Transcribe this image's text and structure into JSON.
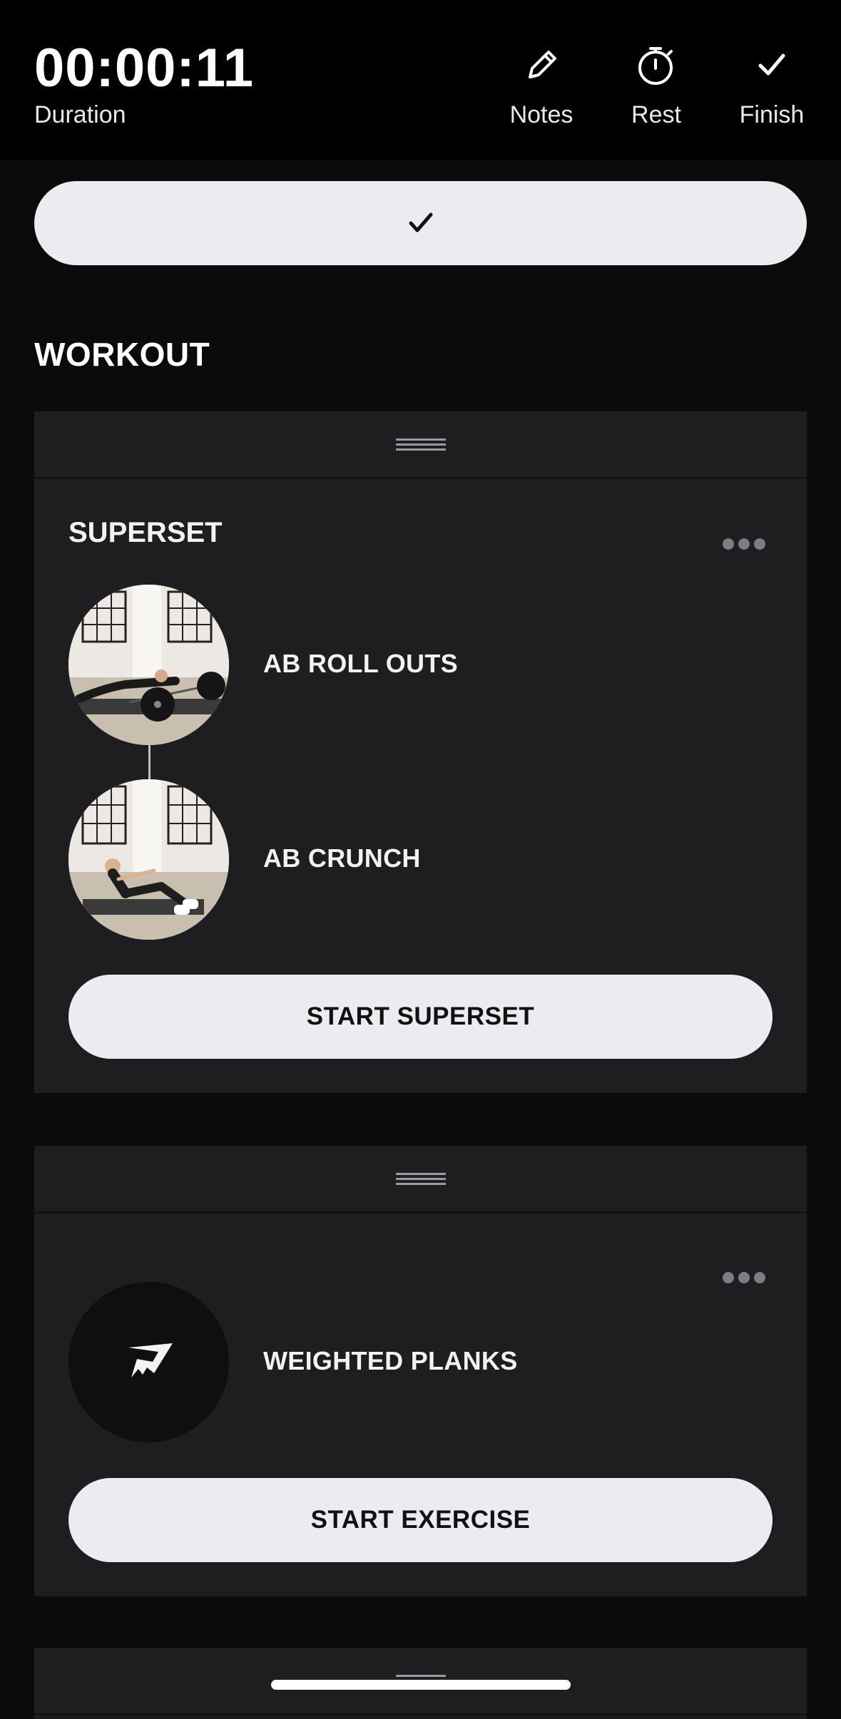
{
  "header": {
    "timer": "00:00:11",
    "timer_label": "Duration",
    "actions": [
      {
        "label": "Notes",
        "icon": "pencil-icon"
      },
      {
        "label": "Rest",
        "icon": "stopwatch-icon"
      },
      {
        "label": "Finish",
        "icon": "checkmark-icon"
      }
    ]
  },
  "complete_button": {
    "icon": "checkmark-icon"
  },
  "section_title": "WORKOUT",
  "cards": [
    {
      "title": "SUPERSET",
      "exercises": [
        {
          "name": "AB ROLL OUTS"
        },
        {
          "name": "AB CRUNCH"
        }
      ],
      "button_label": "START SUPERSET"
    },
    {
      "exercises": [
        {
          "name": "WEIGHTED PLANKS",
          "icon": "gymshark-logo-icon"
        }
      ],
      "button_label": "START EXERCISE"
    }
  ],
  "colors": {
    "background": "#0b0b0c",
    "card": "#1e1e21",
    "button": "#ebebf0"
  }
}
